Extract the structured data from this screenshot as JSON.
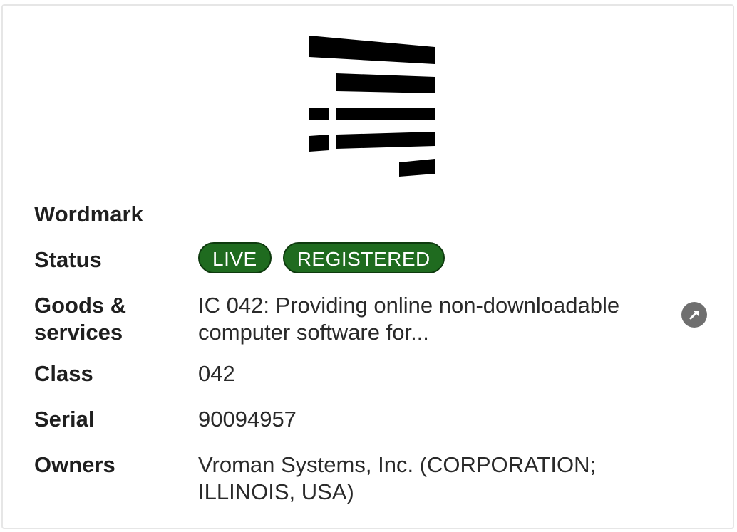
{
  "logo": {
    "icon": "trademark-logo-image"
  },
  "fields": {
    "wordmark": {
      "label": "Wordmark",
      "value": ""
    },
    "status": {
      "label": "Status",
      "badges": [
        "LIVE",
        "REGISTERED"
      ]
    },
    "goods_services": {
      "label_line1": "Goods &",
      "label_line2": "services",
      "value_line1": "IC 042: Providing online non-downloadable",
      "value_line2": "computer software for...",
      "link_icon": "external-link-arrow-icon"
    },
    "class": {
      "label": "Class",
      "value": "042"
    },
    "serial": {
      "label": "Serial",
      "value": "90094957"
    },
    "owners": {
      "label": "Owners",
      "value_line1": "Vroman Systems, Inc. (CORPORATION;",
      "value_line2": "ILLINOIS, USA)"
    }
  },
  "colors": {
    "badge_bg": "#1f6b1f",
    "badge_border": "#0e3a0e",
    "icon_bg": "#6f6f6f"
  }
}
